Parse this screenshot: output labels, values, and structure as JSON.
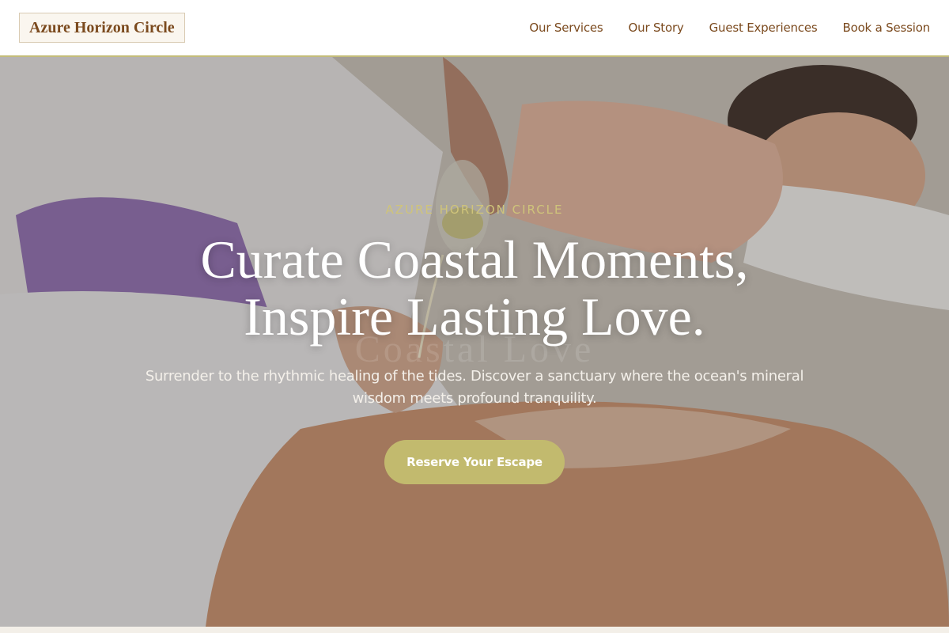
{
  "header": {
    "brand": "Azure Horizon Circle",
    "nav": [
      {
        "label": "Our Services"
      },
      {
        "label": "Our Story"
      },
      {
        "label": "Guest Experiences"
      },
      {
        "label": "Book a Session"
      }
    ]
  },
  "hero": {
    "eyebrow": "AZURE HORIZON CIRCLE",
    "headline_line1": "Curate Coastal Moments,",
    "headline_line2": "Inspire Lasting Love.",
    "ghost_text": "Coastal Love",
    "subtitle": "Surrender to the rhythmic healing of the tides. Discover a sanctuary where the ocean's mineral wisdom meets profound tranquility.",
    "cta_label": "Reserve Your Escape",
    "image_description": "massage-oil-pouring-photo"
  },
  "colors": {
    "brand_text": "#7b4a1e",
    "accent": "#c2ba6e",
    "eyebrow": "#cfc47a",
    "header_border": "#c4bd7a"
  }
}
